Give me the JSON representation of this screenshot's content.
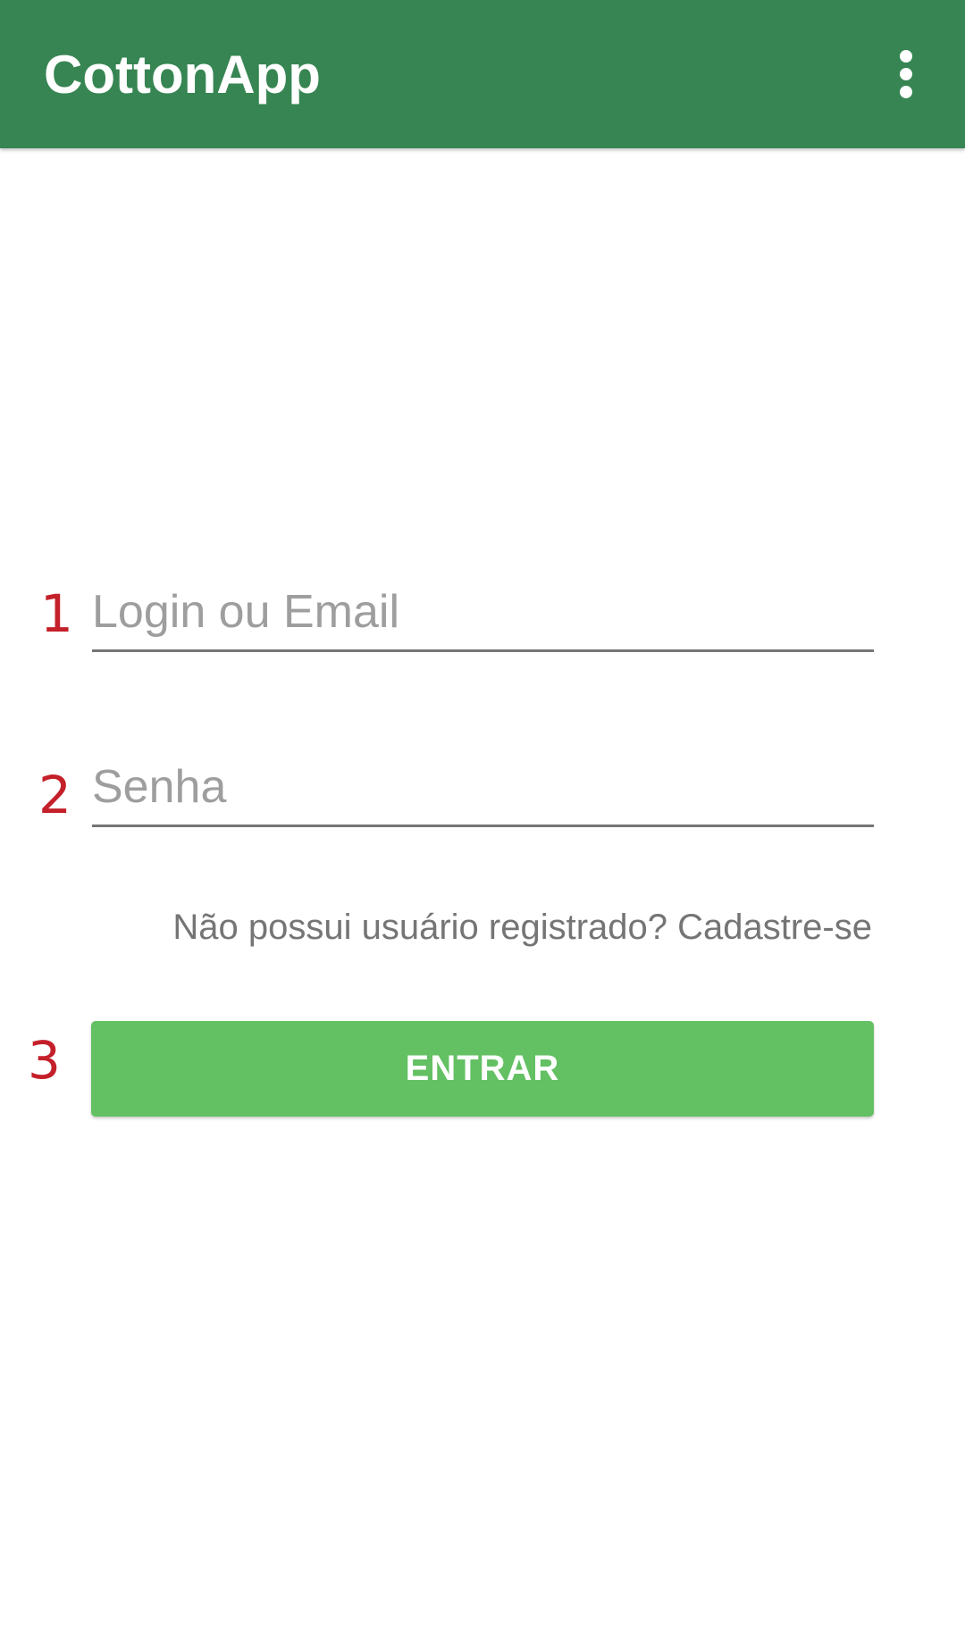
{
  "app_bar": {
    "title": "CottonApp",
    "menu_icon": "more-vert-icon",
    "background_color": "#368552"
  },
  "annotations": {
    "login_marker": "1",
    "password_marker": "2",
    "button_marker": "3"
  },
  "form": {
    "login": {
      "placeholder": "Login ou Email",
      "value": ""
    },
    "password": {
      "placeholder": "Senha",
      "value": ""
    },
    "register_link": "Não possui usuário registrado? Cadastre-se",
    "submit_label": "ENTRAR",
    "button_color": "#63c063"
  }
}
